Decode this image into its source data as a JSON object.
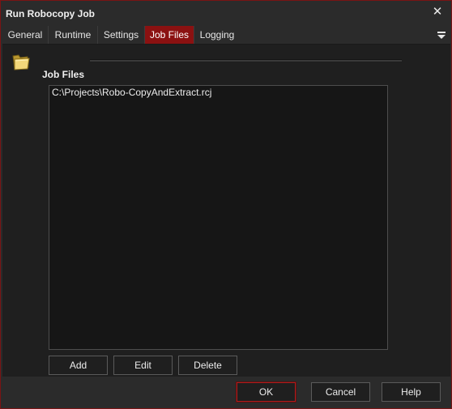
{
  "window": {
    "title": "Run Robocopy Job",
    "close_icon": "close-icon"
  },
  "tabs": [
    {
      "label": "General"
    },
    {
      "label": "Runtime"
    },
    {
      "label": "Settings"
    },
    {
      "label": "Job Files",
      "active": true
    },
    {
      "label": "Logging"
    }
  ],
  "tab_menu_icon": "dropdown-menu-icon",
  "content": {
    "section_icon": "folder-icon",
    "section_label": "Job Files",
    "job_files": [
      "C:\\Projects\\Robo-CopyAndExtract.rcj"
    ],
    "buttons": {
      "add": "Add",
      "edit": "Edit",
      "delete": "Delete"
    }
  },
  "footer": {
    "ok": "OK",
    "cancel": "Cancel",
    "help": "Help"
  },
  "colors": {
    "accent": "#8b1111",
    "background": "#2b2b2b",
    "panel": "#1f1f1f"
  }
}
